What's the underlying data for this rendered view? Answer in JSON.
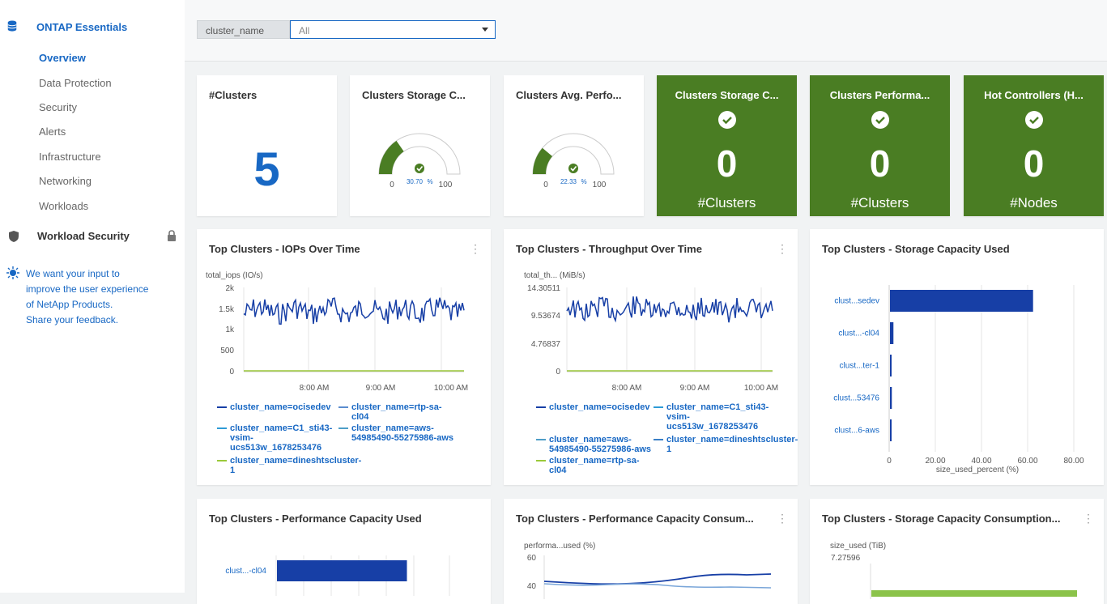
{
  "sidebar": {
    "section_title": "ONTAP Essentials",
    "items": [
      "Overview",
      "Data Protection",
      "Security",
      "Alerts",
      "Infrastructure",
      "Networking",
      "Workloads"
    ],
    "active_item": "Overview",
    "workload_security": "Workload Security",
    "feedback_text": "We want your input to improve the user experience of NetApp Products.",
    "feedback_link": "Share your feedback."
  },
  "filter": {
    "label": "cluster_name",
    "value": "All"
  },
  "cards": {
    "clusters": {
      "title": "#Clusters",
      "value": "5"
    },
    "storage_cap": {
      "title": "Clusters Storage C...",
      "min": "0",
      "max": "100",
      "value": "30.70",
      "unit": "%",
      "fraction": 0.307
    },
    "avg_perf": {
      "title": "Clusters Avg. Perfo...",
      "min": "0",
      "max": "100",
      "value": "22.33",
      "unit": "%",
      "fraction": 0.2233
    },
    "green1": {
      "title": "Clusters Storage C...",
      "value": "0",
      "sub": "#Clusters"
    },
    "green2": {
      "title": "Clusters Performa...",
      "value": "0",
      "sub": "#Clusters"
    },
    "green3": {
      "title": "Hot Controllers (H...",
      "value": "0",
      "sub": "#Nodes"
    }
  },
  "panels": {
    "iops": {
      "title": "Top Clusters - IOPs Over Time",
      "ylabel": "total_iops (IO/s)",
      "yticks": [
        "2k",
        "1.5k",
        "1k",
        "500",
        "0"
      ],
      "xticks": [
        "8:00 AM",
        "9:00 AM",
        "10:00 AM"
      ],
      "legend": [
        "cluster_name=ocisedev",
        "cluster_name=rtp-sa-cl04",
        "cluster_name=C1_sti43-vsim-ucs513w_1678253476",
        "cluster_name=aws-54985490-55275986-aws",
        "cluster_name=dineshtscluster-1"
      ]
    },
    "throughput": {
      "title": "Top Clusters - Throughput Over Time",
      "ylabel": "total_th... (MiB/s)",
      "yticks": [
        "14.30511",
        "9.53674",
        "4.76837",
        "0"
      ],
      "xticks": [
        "8:00 AM",
        "9:00 AM",
        "10:00 AM"
      ],
      "legend": [
        "cluster_name=ocisedev",
        "cluster_name=C1_sti43-vsim-ucs513w_1678253476",
        "cluster_name=aws-54985490-55275986-aws",
        "cluster_name=dineshtscluster-1",
        "cluster_name=rtp-sa-cl04"
      ]
    },
    "storage_used": {
      "title": "Top Clusters - Storage Capacity Used",
      "xlabel": "size_used_percent (%)",
      "xticks": [
        "0",
        "20.00",
        "40.00",
        "60.00",
        "80.00"
      ]
    },
    "perf_used": {
      "title": "Top Clusters - Performance Capacity Used"
    },
    "perf_consumption": {
      "title": "Top Clusters - Performance Capacity Consum...",
      "ylabel": "performa...used (%)",
      "yticks": [
        "60",
        "40"
      ]
    },
    "storage_consumption": {
      "title": "Top Clusters - Storage Capacity Consumption...",
      "ylabel": "size_used (TiB)",
      "yticks": [
        "7.27596"
      ]
    }
  },
  "chart_data": [
    {
      "type": "line",
      "title": "Top Clusters - IOPs Over Time",
      "ylabel": "total_iops (IO/s)",
      "ylim": [
        0,
        2000
      ],
      "series": [
        {
          "name": "cluster_name=ocisedev",
          "values": [
            1300,
            1450,
            1200,
            1500,
            1280,
            1400,
            1250,
            1350,
            1300,
            1260,
            1400,
            1300
          ]
        },
        {
          "name": "cluster_name=dineshtscluster-1",
          "values": [
            0,
            0,
            0,
            0,
            0,
            0,
            0,
            0,
            0,
            0,
            0,
            0
          ]
        }
      ]
    },
    {
      "type": "line",
      "title": "Top Clusters - Throughput Over Time",
      "ylabel": "total_th... (MiB/s)",
      "ylim": [
        0,
        14.30511
      ],
      "series": [
        {
          "name": "cluster_name=ocisedev",
          "values": [
            9.0,
            10.0,
            8.8,
            10.2,
            9.1,
            9.8,
            8.9,
            9.6,
            9.3,
            8.7,
            9.9,
            9.2
          ]
        },
        {
          "name": "cluster_name=dineshtscluster-1",
          "values": [
            0,
            0,
            0,
            0,
            0,
            0,
            0,
            0,
            0,
            0,
            0,
            0
          ]
        }
      ]
    },
    {
      "type": "bar",
      "title": "Top Clusters - Storage Capacity Used",
      "xlabel": "size_used_percent (%)",
      "xlim": [
        0,
        80
      ],
      "categories": [
        "clust...sedev",
        "clust...-cl04",
        "clust...ter-1",
        "clust...53476",
        "clust...6-aws"
      ],
      "values": [
        62,
        1.5,
        0.6,
        0.8,
        0.7
      ]
    },
    {
      "type": "bar",
      "title": "Top Clusters - Performance Capacity Used",
      "categories": [
        "clust...-cl04"
      ],
      "values": [
        60
      ]
    }
  ]
}
